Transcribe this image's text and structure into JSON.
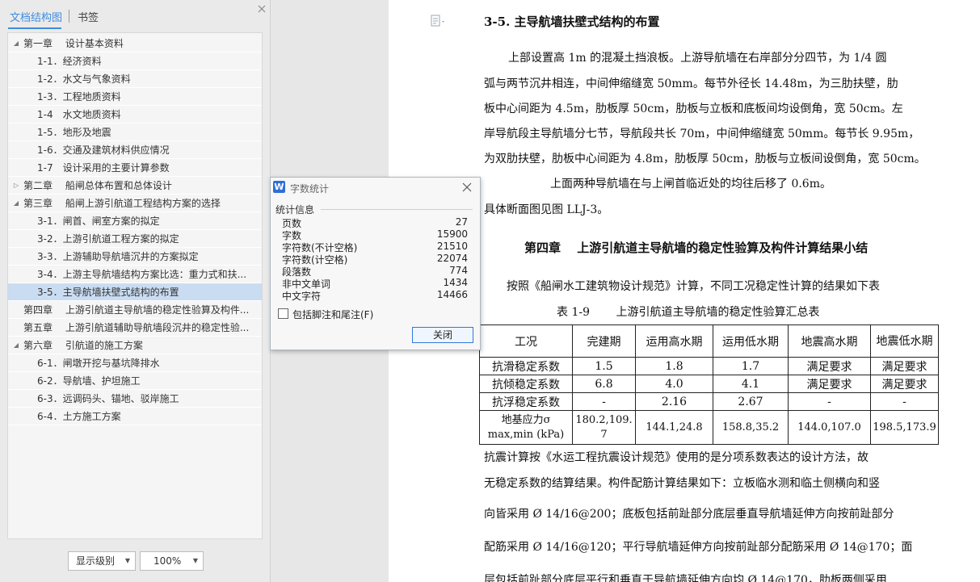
{
  "nav": {
    "tab_outline": "文档结构图",
    "tab_bookmark": "书签",
    "items": [
      {
        "label": "第一章　 设计基本资料",
        "level": 1,
        "expanded": true,
        "has_children": true
      },
      {
        "label": "1-1．经济资料",
        "level": 2
      },
      {
        "label": "1-2．水文与气象资料",
        "level": 2
      },
      {
        "label": "1-3．工程地质资料",
        "level": 2
      },
      {
        "label": "1-4　水文地质资料",
        "level": 2
      },
      {
        "label": "1-5．地形及地震",
        "level": 2
      },
      {
        "label": "1-6．交通及建筑材料供应情况",
        "level": 2
      },
      {
        "label": "1-7　设计采用的主要计算参数",
        "level": 2
      },
      {
        "label": "第二章　 船闸总体布置和总体设计",
        "level": 1,
        "expanded": false,
        "has_children": true
      },
      {
        "label": "第三章　 船闸上游引航道工程结构方案的选择",
        "level": 1,
        "expanded": true,
        "has_children": true
      },
      {
        "label": "3-1．闸首、闸室方案的拟定",
        "level": 2
      },
      {
        "label": "3-2．上游引航道工程方案的拟定",
        "level": 2
      },
      {
        "label": "3-3．上游辅助导航墙沉井的方案拟定",
        "level": 2
      },
      {
        "label": "3-4．上游主导航墙结构方案比选：重力式和扶...",
        "level": 2
      },
      {
        "label": "3-5．主导航墙扶壁式结构的布置",
        "level": 2,
        "selected": true
      },
      {
        "label": "第四章　 上游引航道主导航墙的稳定性验算及构件...",
        "level": 1,
        "has_children": false
      },
      {
        "label": "第五章　 上游引航道辅助导航墙段沉井的稳定性验...",
        "level": 1,
        "has_children": false
      },
      {
        "label": "第六章　 引航道的施工方案",
        "level": 1,
        "expanded": true,
        "has_children": true
      },
      {
        "label": "6-1．闸墩开挖与基坑降排水",
        "level": 2
      },
      {
        "label": "6-2．导航墙、护坦施工",
        "level": 2
      },
      {
        "label": "6-3．远调码头、锚地、驳岸施工",
        "level": 2
      },
      {
        "label": "6-4．土方施工方案",
        "level": 2
      }
    ],
    "level_dropdown": "显示级别",
    "zoom_dropdown": "100%"
  },
  "dialog": {
    "title": "字数统计",
    "section": "统计信息",
    "stats": [
      {
        "label": "页数",
        "value": "27"
      },
      {
        "label": "字数",
        "value": "15900"
      },
      {
        "label": "字符数(不计空格)",
        "value": "21510"
      },
      {
        "label": "字符数(计空格)",
        "value": "22074"
      },
      {
        "label": "段落数",
        "value": "774"
      },
      {
        "label": "非中文单词",
        "value": "1434"
      },
      {
        "label": "中文字符",
        "value": "14466"
      }
    ],
    "checkbox_label": "包括脚注和尾注(F)",
    "checkbox_checked": false,
    "close_button": "关闭"
  },
  "doc": {
    "heading_35": "3-5. 主导航墙扶壁式结构的布置",
    "p1_l1": "上部设置高 1m 的混凝土挡浪板。上游导航墙在右岸部分分四节，为 1/4 圆",
    "p1_l2": "弧与两节沉井相连，中间伸缩缝宽 50mm。每节外径长 14.48m，为三肋扶壁，肋",
    "p1_l3": "板中心间距为 4.5m，肋板厚 50cm，肋板与立板和底板间均设倒角，宽 50cm。左",
    "p1_l4": "岸导航段主导航墙分七节，导航段共长 70m，中间伸缩缝宽 50mm。每节长 9.95m，",
    "p1_l5": "为双肋扶壁，肋板中心间距为 4.8m，肋板厚 50cm，肋板与立板间设倒角，宽 50cm。",
    "p2": "上面两种导航墙在与上闸首临近处的均往后移了 0.6m。",
    "p3": "具体断面图见图 LLJ-3。",
    "chapter4": "第四章　 上游引航道主导航墙的稳定性验算及构件计算结果小结",
    "p4": "按照《船闸水工建筑物设计规范》计算，不同工况稳定性计算的结果如下表",
    "table_caption": "表 1-9　　 上游引航道主导航墙的稳定性验算汇总表",
    "table_header": [
      "工况",
      "完建期",
      "运用高水期",
      "运用低水期",
      "地震高水期",
      "地震低水期"
    ],
    "table_rows": [
      [
        "抗滑稳定系数",
        "1.5",
        "1.8",
        "1.7",
        "满足要求",
        "满足要求"
      ],
      [
        "抗倾稳定系数",
        "6.8",
        "4.0",
        "4.1",
        "满足要求",
        "满足要求"
      ],
      [
        "抗浮稳定系数",
        "-",
        "2.16",
        "2.67",
        "-",
        "-"
      ],
      [
        "地基应力σ max,min (kPa)",
        "180.2,109.7",
        "144.1,24.8",
        "158.8,35.2",
        "144.0,107.0",
        "198.5,173.9"
      ]
    ],
    "p5_l1": "抗震计算按《水运工程抗震设计规范》使用的是分项系数表达的设计方法，故",
    "p5_l2": "无稳定系数的结算结果。构件配筋计算结果如下：立板临水测和临土侧横向和竖",
    "p5_l3": "向皆采用 Ø 14/16@200；底板包括前趾部分底层垂直导航墙延伸方向按前趾部分",
    "p5_l4": "配筋采用 Ø 14/16@120；平行导航墙延伸方向按前趾部分配筋采用 Ø 14@170；面",
    "p5_l5": "层包括前趾部分底层平行和垂直于导航墙延伸方向均 Ø 14@170，肋板两侧采用"
  }
}
